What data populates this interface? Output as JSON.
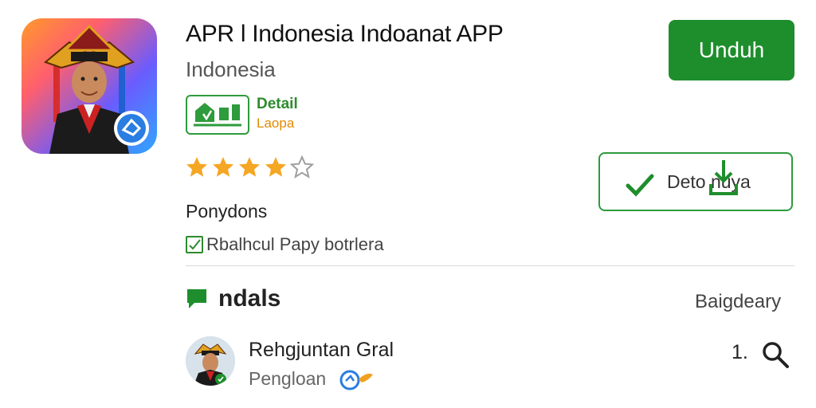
{
  "app": {
    "title": "APR l Indonesia Indoanat APP",
    "subtitle": "Indonesia",
    "icon": "app-logo-traditional-figure"
  },
  "detail": {
    "title": "Detail",
    "subtitle": "Laopa"
  },
  "rating": {
    "stars_filled": 4,
    "stars_total": 5,
    "colors": {
      "filled": "#f5a623",
      "empty": "#9e9e9e"
    }
  },
  "publisher": "Ponydons",
  "payment_note": "Rbalhcul Papy botrlera",
  "buttons": {
    "download": "Unduh",
    "detail_download": "Deto nuya"
  },
  "section": {
    "title": "ndals",
    "link": "Baigdeary"
  },
  "list": [
    {
      "title": "Rehgjuntan Gral",
      "subtitle": "Pengloan",
      "count": "1.",
      "icon": "search-icon"
    }
  ],
  "colors": {
    "accent_green": "#1e8e2c",
    "badge_orange": "#e08a00"
  }
}
